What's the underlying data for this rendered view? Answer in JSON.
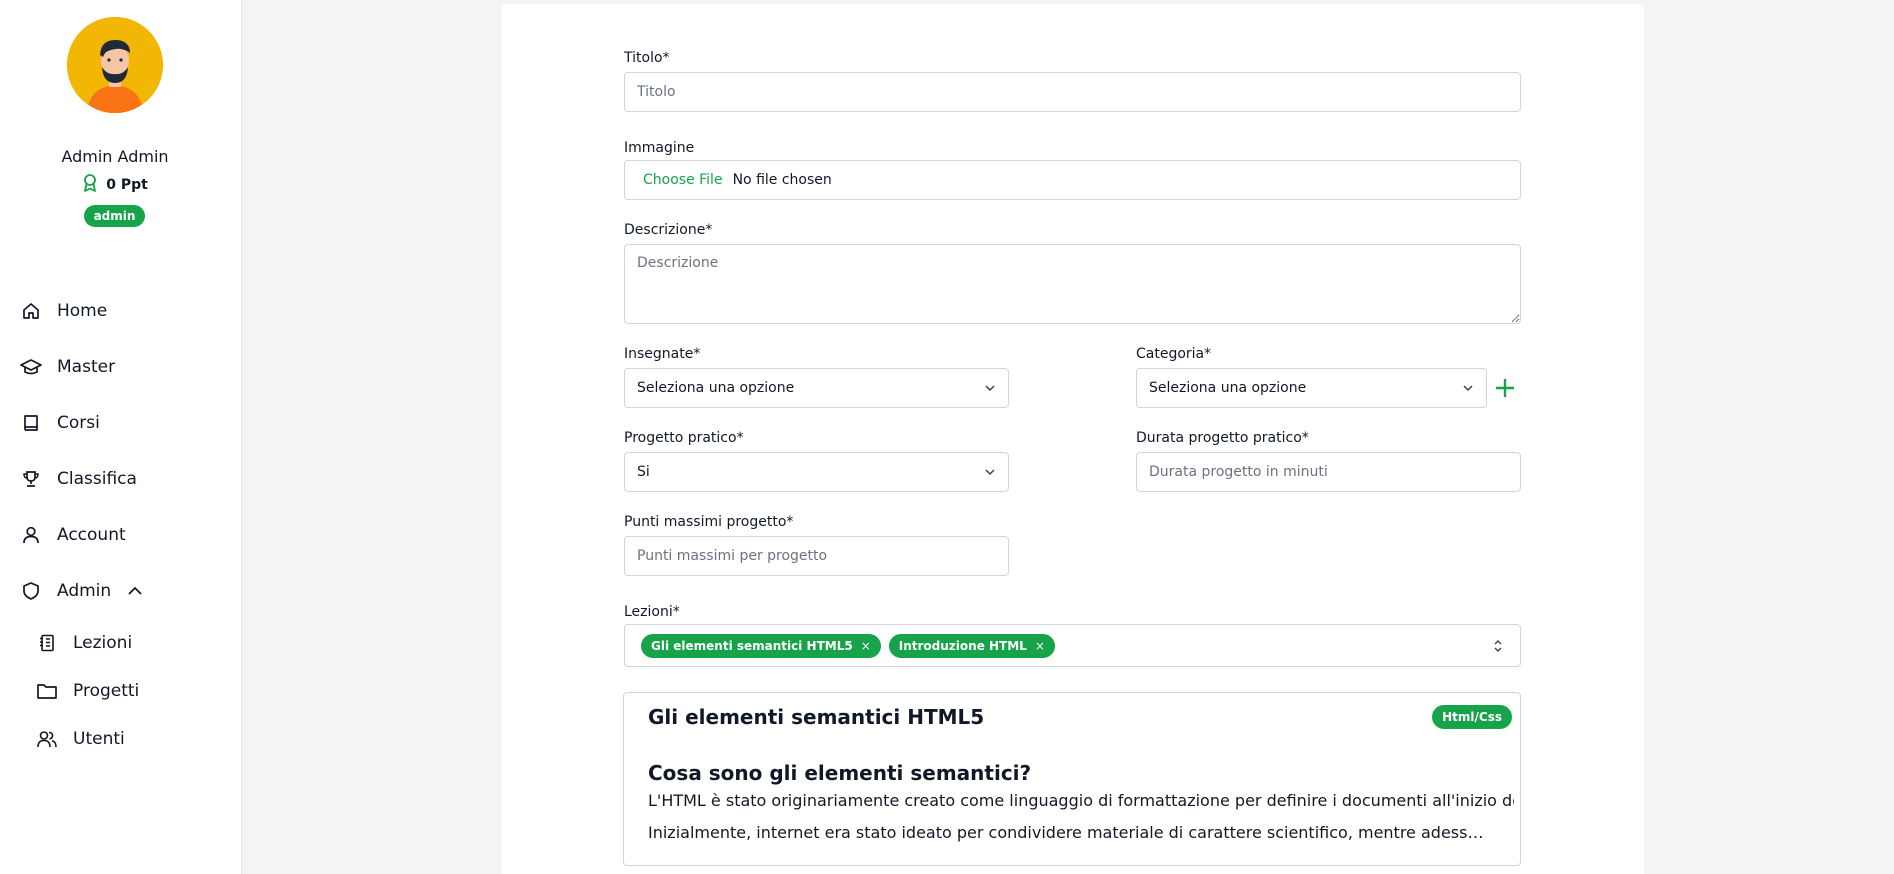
{
  "sidebar": {
    "user_name": "Admin Admin",
    "points": "0 Ppt",
    "role": "admin",
    "nav": [
      {
        "label": "Home"
      },
      {
        "label": "Master"
      },
      {
        "label": "Corsi"
      },
      {
        "label": "Classifica"
      },
      {
        "label": "Account"
      },
      {
        "label": "Admin"
      }
    ],
    "admin_sub": [
      {
        "label": "Lezioni"
      },
      {
        "label": "Progetti"
      },
      {
        "label": "Utenti"
      }
    ]
  },
  "form": {
    "titolo_label": "Titolo*",
    "titolo_placeholder": "Titolo",
    "titolo_value": "",
    "immagine_label": "Immagine",
    "file_button": "Choose File",
    "file_status": "No file chosen",
    "descrizione_label": "Descrizione*",
    "descrizione_placeholder": "Descrizione",
    "insegnate_label": "Insegnate*",
    "insegnate_value": "Seleziona una opzione",
    "categoria_label": "Categoria*",
    "categoria_value": "Seleziona una opzione",
    "progetto_label": "Progetto pratico*",
    "progetto_value": "Si",
    "durata_label": "Durata progetto pratico*",
    "durata_placeholder": "Durata progetto in minuti",
    "punti_label": "Punti massimi progetto*",
    "punti_placeholder": "Punti massimi per progetto",
    "lezioni_label": "Lezioni*",
    "lezioni_tags": [
      {
        "label": "Gli elementi semantici HTML5",
        "remove": "×"
      },
      {
        "label": "Introduzione HTML",
        "remove": "×"
      }
    ]
  },
  "preview": {
    "title": "Gli elementi semantici HTML5",
    "category": "Html/Css",
    "heading": "Cosa sono gli elementi semantici?",
    "paragraph1": "L'HTML è stato originariamente creato come linguaggio di formattazione per definire i documenti all'inizio dell'av",
    "paragraph2": "Inizialmente, internet era stato ideato per condividere materiale di carattere scientifico, mentre adesso le p…"
  },
  "colors": {
    "accent": "#16a34a",
    "avatar_bg": "#f2b705"
  }
}
